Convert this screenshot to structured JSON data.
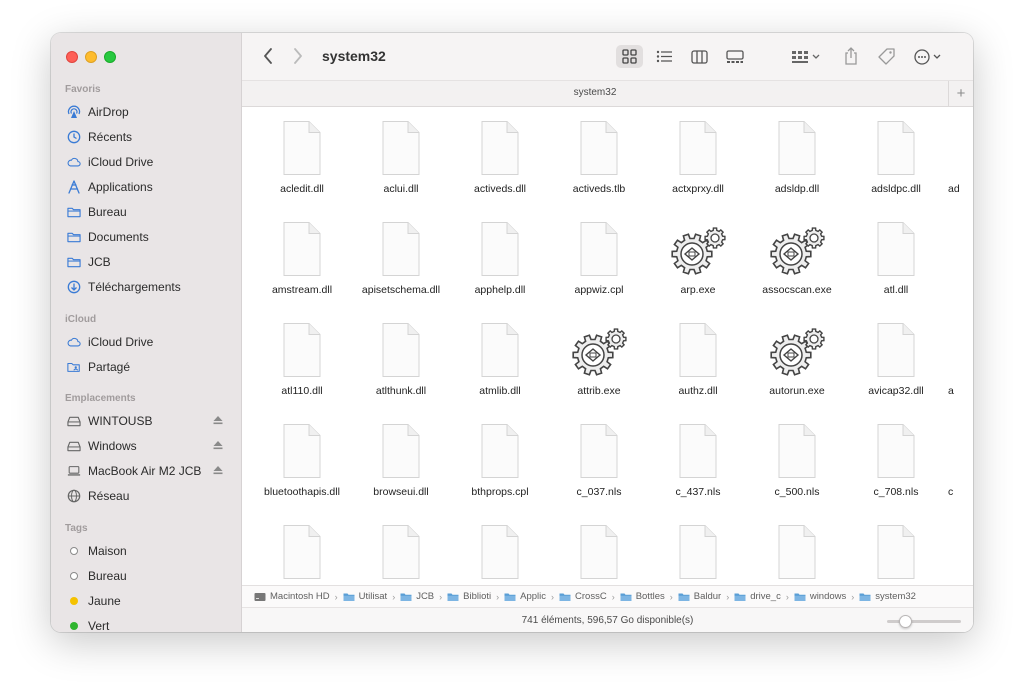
{
  "window": {
    "title": "system32",
    "tab_title": "system32",
    "tab_add": "+"
  },
  "sidebar": {
    "favorites": {
      "header": "Favoris",
      "items": [
        {
          "label": "AirDrop",
          "icon": "airdrop-icon"
        },
        {
          "label": "Récents",
          "icon": "clock-icon"
        },
        {
          "label": "iCloud Drive",
          "icon": "cloud-icon"
        },
        {
          "label": "Applications",
          "icon": "applications-icon"
        },
        {
          "label": "Bureau",
          "icon": "folder-icon"
        },
        {
          "label": "Documents",
          "icon": "folder-icon"
        },
        {
          "label": "JCB",
          "icon": "folder-icon"
        },
        {
          "label": "Téléchargements",
          "icon": "download-icon"
        }
      ]
    },
    "icloud": {
      "header": "iCloud",
      "items": [
        {
          "label": "iCloud Drive",
          "icon": "cloud-icon"
        },
        {
          "label": "Partagé",
          "icon": "shared-folder-icon"
        }
      ]
    },
    "locations": {
      "header": "Emplacements",
      "items": [
        {
          "label": "WINTOUSB",
          "icon": "drive-icon",
          "eject": true
        },
        {
          "label": "Windows",
          "icon": "drive-icon",
          "eject": true
        },
        {
          "label": "MacBook Air M2 JCB",
          "icon": "laptop-icon",
          "eject": true
        },
        {
          "label": "Réseau",
          "icon": "network-icon",
          "eject": false
        }
      ]
    },
    "tags": {
      "header": "Tags",
      "items": [
        {
          "label": "Maison",
          "color": "#ffffff"
        },
        {
          "label": "Bureau",
          "color": "#ffffff"
        },
        {
          "label": "Jaune",
          "color": "#f5c200"
        },
        {
          "label": "Vert",
          "color": "#2fb52f"
        }
      ]
    }
  },
  "files": [
    {
      "name": "acledit.dll",
      "type": "doc"
    },
    {
      "name": "aclui.dll",
      "type": "doc"
    },
    {
      "name": "activeds.dll",
      "type": "doc"
    },
    {
      "name": "activeds.tlb",
      "type": "doc"
    },
    {
      "name": "actxprxy.dll",
      "type": "doc"
    },
    {
      "name": "adsldp.dll",
      "type": "doc"
    },
    {
      "name": "adsldpc.dll",
      "type": "doc"
    },
    {
      "name": "ad",
      "type": "partial"
    },
    {
      "name": "amstream.dll",
      "type": "doc"
    },
    {
      "name": "apisetschema.dll",
      "type": "doc"
    },
    {
      "name": "apphelp.dll",
      "type": "doc"
    },
    {
      "name": "appwiz.cpl",
      "type": "doc"
    },
    {
      "name": "arp.exe",
      "type": "exe"
    },
    {
      "name": "assocscan.exe",
      "type": "exe"
    },
    {
      "name": "atl.dll",
      "type": "doc"
    },
    {
      "name": "",
      "type": "partial"
    },
    {
      "name": "atl110.dll",
      "type": "doc"
    },
    {
      "name": "atlthunk.dll",
      "type": "doc"
    },
    {
      "name": "atmlib.dll",
      "type": "doc"
    },
    {
      "name": "attrib.exe",
      "type": "exe"
    },
    {
      "name": "authz.dll",
      "type": "doc"
    },
    {
      "name": "autorun.exe",
      "type": "exe"
    },
    {
      "name": "avicap32.dll",
      "type": "doc"
    },
    {
      "name": "a",
      "type": "partial"
    },
    {
      "name": "bluetoothapis.dll",
      "type": "doc"
    },
    {
      "name": "browseui.dll",
      "type": "doc"
    },
    {
      "name": "bthprops.cpl",
      "type": "doc"
    },
    {
      "name": "c_037.nls",
      "type": "doc"
    },
    {
      "name": "c_437.nls",
      "type": "doc"
    },
    {
      "name": "c_500.nls",
      "type": "doc"
    },
    {
      "name": "c_708.nls",
      "type": "doc"
    },
    {
      "name": "c",
      "type": "partial"
    },
    {
      "name": "",
      "type": "doc"
    },
    {
      "name": "",
      "type": "doc"
    },
    {
      "name": "",
      "type": "doc"
    },
    {
      "name": "",
      "type": "doc"
    },
    {
      "name": "",
      "type": "doc"
    },
    {
      "name": "",
      "type": "doc"
    },
    {
      "name": "",
      "type": "doc"
    }
  ],
  "pathbar": [
    {
      "label": "Macintosh HD",
      "icon": "hard-disk-icon"
    },
    {
      "label": "Utilisat",
      "icon": "folder-icon"
    },
    {
      "label": "JCB",
      "icon": "folder-icon"
    },
    {
      "label": "Biblioti",
      "icon": "folder-icon"
    },
    {
      "label": "Applic",
      "icon": "folder-icon"
    },
    {
      "label": "CrossC",
      "icon": "folder-icon"
    },
    {
      "label": "Bottles",
      "icon": "folder-icon"
    },
    {
      "label": "Baldur",
      "icon": "folder-icon"
    },
    {
      "label": "drive_c",
      "icon": "folder-icon"
    },
    {
      "label": "windows",
      "icon": "folder-icon"
    },
    {
      "label": "system32",
      "icon": "folder-icon"
    }
  ],
  "status": {
    "text": "741 éléments, 596,57 Go disponible(s)",
    "icon_size_level": 0.25
  },
  "colors": {
    "accent": "#3a7bd5",
    "folder": "#5a9fd6",
    "sidebar_bg": "#e9e5e6"
  }
}
